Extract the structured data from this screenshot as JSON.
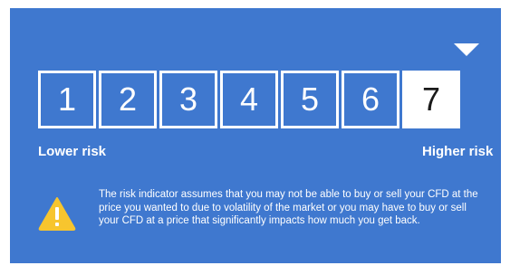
{
  "risk_scale": {
    "levels": [
      "1",
      "2",
      "3",
      "4",
      "5",
      "6",
      "7"
    ],
    "selected": "7"
  },
  "labels": {
    "lower": "Lower risk",
    "higher": "Higher risk"
  },
  "warning": {
    "icon": "warning-triangle-icon",
    "text": "The risk indicator assumes that you may not be able to buy or sell your CFD at the price you wanted to  due to volatility of the market or you may have to buy or sell your CFD at a price that significantly impacts how much you get back."
  },
  "colors": {
    "background": "#3f78cf",
    "foreground": "#ffffff",
    "warning": "#f7c52e"
  }
}
